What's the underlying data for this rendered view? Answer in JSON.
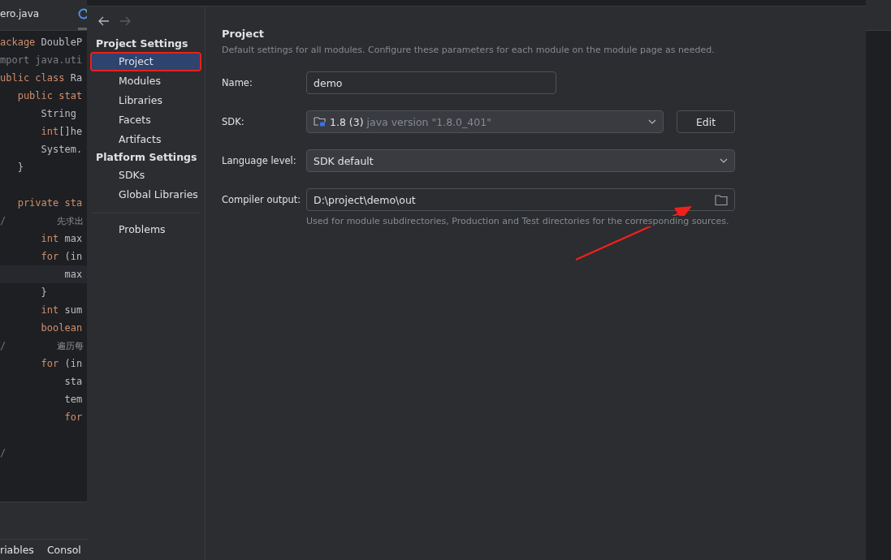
{
  "editor": {
    "tabs": [
      {
        "label": "ero.java",
        "selected": false
      },
      {
        "selected": true
      }
    ],
    "code_lines": [
      {
        "tokens": [
          {
            "kind": "keyword",
            "text": "ackage"
          },
          {
            "kind": "plain",
            "text": " DoubleP"
          }
        ]
      },
      {
        "tokens": [
          {
            "kind": "muted",
            "text": "mport java.uti"
          }
        ]
      },
      {
        "tokens": [
          {
            "kind": "keyword",
            "text": "ublic class"
          },
          {
            "kind": "plain",
            "text": " Ra"
          }
        ]
      },
      {
        "tokens": [
          {
            "kind": "keyword",
            "text": "   public stat"
          }
        ]
      },
      {
        "tokens": [
          {
            "kind": "plain",
            "text": "       String"
          }
        ]
      },
      {
        "tokens": [
          {
            "kind": "keyword",
            "text": "       int"
          },
          {
            "kind": "plain",
            "text": "[]he"
          }
        ]
      },
      {
        "tokens": [
          {
            "kind": "plain",
            "text": "       System."
          }
        ]
      },
      {
        "tokens": [
          {
            "kind": "plain",
            "text": "   }"
          }
        ]
      },
      {
        "blank_before": true,
        "tokens": [
          {
            "kind": "keyword",
            "text": "   private sta"
          }
        ]
      },
      {
        "gutter": "/",
        "tokens": [
          {
            "kind": "comment",
            "text": "先求出"
          }
        ]
      },
      {
        "tokens": [
          {
            "kind": "keyword",
            "text": "       int"
          },
          {
            "kind": "plain",
            "text": " max"
          }
        ]
      },
      {
        "tokens": [
          {
            "kind": "keyword",
            "text": "       for"
          },
          {
            "kind": "plain",
            "text": " (in"
          }
        ]
      },
      {
        "current": true,
        "tokens": [
          {
            "kind": "plain",
            "text": "           max"
          }
        ]
      },
      {
        "tokens": [
          {
            "kind": "plain",
            "text": "       }"
          }
        ]
      },
      {
        "tokens": [
          {
            "kind": "keyword",
            "text": "       int"
          },
          {
            "kind": "plain",
            "text": " sum"
          }
        ]
      },
      {
        "tokens": [
          {
            "kind": "keyword",
            "text": "       boolean"
          }
        ]
      },
      {
        "gutter": "/",
        "tokens": [
          {
            "kind": "comment",
            "text": "遍历每"
          }
        ]
      },
      {
        "tokens": [
          {
            "kind": "keyword",
            "text": "       for"
          },
          {
            "kind": "plain",
            "text": " (in"
          }
        ]
      },
      {
        "tokens": [
          {
            "kind": "plain",
            "text": "           sta"
          }
        ]
      },
      {
        "tokens": [
          {
            "kind": "plain",
            "text": "           tem"
          }
        ]
      },
      {
        "tokens": [
          {
            "kind": "keyword",
            "text": "           for"
          }
        ]
      },
      {
        "blank_before": true,
        "gutter": "/"
      }
    ],
    "bottom_tabs": [
      "riables",
      "Consol"
    ]
  },
  "dialog": {
    "sidebar": {
      "sections": [
        {
          "title": "Project Settings",
          "items": [
            {
              "label": "Project",
              "selected": true,
              "highlighted": true
            },
            {
              "label": "Modules",
              "selected": false,
              "highlighted": false
            },
            {
              "label": "Libraries",
              "selected": false,
              "highlighted": false
            },
            {
              "label": "Facets",
              "selected": false,
              "highlighted": false
            },
            {
              "label": "Artifacts",
              "selected": false,
              "highlighted": false
            }
          ]
        },
        {
          "title": "Platform Settings",
          "items": [
            {
              "label": "SDKs",
              "selected": false,
              "highlighted": false
            },
            {
              "label": "Global Libraries",
              "selected": false,
              "highlighted": false
            }
          ]
        }
      ],
      "extra_items": [
        {
          "label": "Problems",
          "selected": false,
          "highlighted": false
        }
      ]
    },
    "content": {
      "title": "Project",
      "description": "Default settings for all modules. Configure these parameters for each module on the module page as needed.",
      "fields": [
        {
          "kind": "text",
          "label": "Name:",
          "value": "demo"
        },
        {
          "kind": "sdk",
          "label": "SDK:",
          "value": "1.8 (3)",
          "detail": "java version \"1.8.0_401\"",
          "button": "Edit"
        },
        {
          "kind": "select",
          "label": "Language level:",
          "value": "SDK default"
        },
        {
          "kind": "path",
          "label": "Compiler output:",
          "value": "D:\\project\\demo\\out",
          "hint": "Used for module subdirectories, Production and Test directories for the corresponding sources.",
          "pointer_arrow": true
        }
      ]
    }
  }
}
